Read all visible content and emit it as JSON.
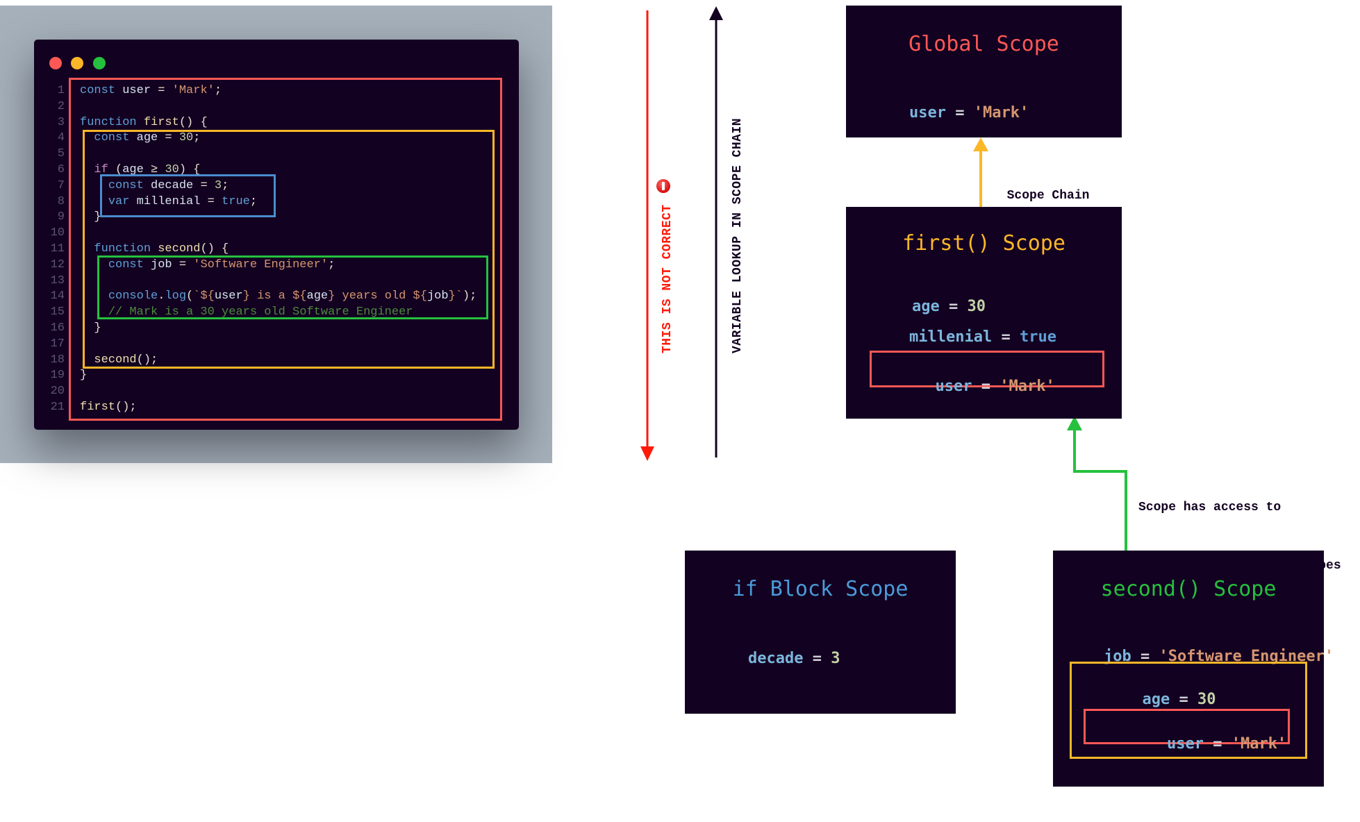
{
  "code_window": {
    "traffic_lights": [
      "close",
      "minimize",
      "maximize"
    ],
    "lines": [
      {
        "n": "1",
        "tokens": [
          [
            "kw",
            "const"
          ],
          [
            "punc",
            " "
          ],
          [
            "var",
            "user"
          ],
          [
            "punc",
            " = "
          ],
          [
            "str",
            "'Mark'"
          ],
          [
            "punc",
            ";"
          ]
        ]
      },
      {
        "n": "2",
        "tokens": []
      },
      {
        "n": "3",
        "tokens": [
          [
            "kw",
            "function"
          ],
          [
            "punc",
            " "
          ],
          [
            "fn",
            "first"
          ],
          [
            "punc",
            "() {"
          ]
        ]
      },
      {
        "n": "4",
        "tokens": [
          [
            "punc",
            "  "
          ],
          [
            "kw",
            "const"
          ],
          [
            "punc",
            " "
          ],
          [
            "var",
            "age"
          ],
          [
            "punc",
            " = "
          ],
          [
            "num",
            "30"
          ],
          [
            "punc",
            ";"
          ]
        ]
      },
      {
        "n": "5",
        "tokens": []
      },
      {
        "n": "6",
        "tokens": [
          [
            "punc",
            "  "
          ],
          [
            "ctl",
            "if"
          ],
          [
            "punc",
            " ("
          ],
          [
            "var",
            "age"
          ],
          [
            "punc",
            " ≥ "
          ],
          [
            "num",
            "30"
          ],
          [
            "punc",
            ") {"
          ]
        ]
      },
      {
        "n": "7",
        "tokens": [
          [
            "punc",
            "    "
          ],
          [
            "kw",
            "const"
          ],
          [
            "punc",
            " "
          ],
          [
            "var",
            "decade"
          ],
          [
            "punc",
            " = "
          ],
          [
            "num",
            "3"
          ],
          [
            "punc",
            ";"
          ]
        ]
      },
      {
        "n": "8",
        "tokens": [
          [
            "punc",
            "    "
          ],
          [
            "kw",
            "var"
          ],
          [
            "punc",
            " "
          ],
          [
            "var",
            "millenial"
          ],
          [
            "punc",
            " = "
          ],
          [
            "bool",
            "true"
          ],
          [
            "punc",
            ";"
          ]
        ]
      },
      {
        "n": "9",
        "tokens": [
          [
            "punc",
            "  }"
          ]
        ]
      },
      {
        "n": "10",
        "tokens": []
      },
      {
        "n": "11",
        "tokens": [
          [
            "punc",
            "  "
          ],
          [
            "kw",
            "function"
          ],
          [
            "punc",
            " "
          ],
          [
            "fn",
            "second"
          ],
          [
            "punc",
            "() {"
          ]
        ]
      },
      {
        "n": "12",
        "tokens": [
          [
            "punc",
            "    "
          ],
          [
            "kw",
            "const"
          ],
          [
            "punc",
            " "
          ],
          [
            "var",
            "job"
          ],
          [
            "punc",
            " = "
          ],
          [
            "str",
            "'Software Engineer'"
          ],
          [
            "punc",
            ";"
          ]
        ]
      },
      {
        "n": "13",
        "tokens": []
      },
      {
        "n": "14",
        "tokens": [
          [
            "punc",
            "    "
          ],
          [
            "kw",
            "console"
          ],
          [
            "punc",
            "."
          ],
          [
            "kw",
            "log"
          ],
          [
            "punc",
            "("
          ],
          [
            "str",
            "`${"
          ],
          [
            "var",
            "user"
          ],
          [
            "str",
            "} is a ${"
          ],
          [
            "var",
            "age"
          ],
          [
            "str",
            "} years old ${"
          ],
          [
            "var",
            "job"
          ],
          [
            "str",
            "}`"
          ],
          [
            "punc",
            ");"
          ]
        ]
      },
      {
        "n": "15",
        "tokens": [
          [
            "punc",
            "    "
          ],
          [
            "cmt",
            "// Mark is a 30 years old Software Engineer"
          ]
        ]
      },
      {
        "n": "16",
        "tokens": [
          [
            "punc",
            "  }"
          ]
        ]
      },
      {
        "n": "17",
        "tokens": []
      },
      {
        "n": "18",
        "tokens": [
          [
            "punc",
            "  "
          ],
          [
            "fn",
            "second"
          ],
          [
            "punc",
            "();"
          ]
        ]
      },
      {
        "n": "19",
        "tokens": [
          [
            "punc",
            "}"
          ]
        ]
      },
      {
        "n": "20",
        "tokens": []
      },
      {
        "n": "21",
        "tokens": [
          [
            "fn",
            "first"
          ],
          [
            "punc",
            "();"
          ]
        ]
      }
    ]
  },
  "labels": {
    "not_correct": "THIS IS NOT CORRECT",
    "lookup": "VARIABLE LOOKUP IN SCOPE CHAIN",
    "scope_chain": "Scope Chain",
    "access_note_line1": "Scope has access to",
    "access_note_line2": "variables from outer scopes"
  },
  "icons": {
    "warning": "stop-icon"
  },
  "colors": {
    "global": "#fb5855",
    "first": "#fcb728",
    "if_block": "#4a8dcf",
    "second": "#25c13e",
    "wrong_arrow": "#ff1a0a",
    "lookup_arrow": "#130121"
  },
  "scopes": {
    "global": {
      "title": "Global Scope",
      "vars": [
        {
          "name": "user",
          "eq": " = ",
          "value": "'Mark'"
        }
      ]
    },
    "first": {
      "title": "first() Scope",
      "vars": [
        {
          "name": "age",
          "eq": " = ",
          "value": "30"
        },
        {
          "name": "millenial",
          "eq": " = ",
          "value": "true"
        }
      ],
      "inherited": [
        {
          "name": "user",
          "eq": " = ",
          "value": "'Mark'"
        }
      ]
    },
    "if_block": {
      "title": "if Block Scope",
      "vars": [
        {
          "name": "decade",
          "eq": " = ",
          "value": "3"
        }
      ]
    },
    "second": {
      "title": "second() Scope",
      "vars": [
        {
          "name": "job",
          "eq": " = ",
          "value": "'Software Engineer'"
        }
      ],
      "inherited_first": [
        {
          "name": "age",
          "eq": " = ",
          "value": "30"
        }
      ],
      "inherited_global": [
        {
          "name": "user",
          "eq": " = ",
          "value": "'Mark'"
        }
      ]
    }
  }
}
